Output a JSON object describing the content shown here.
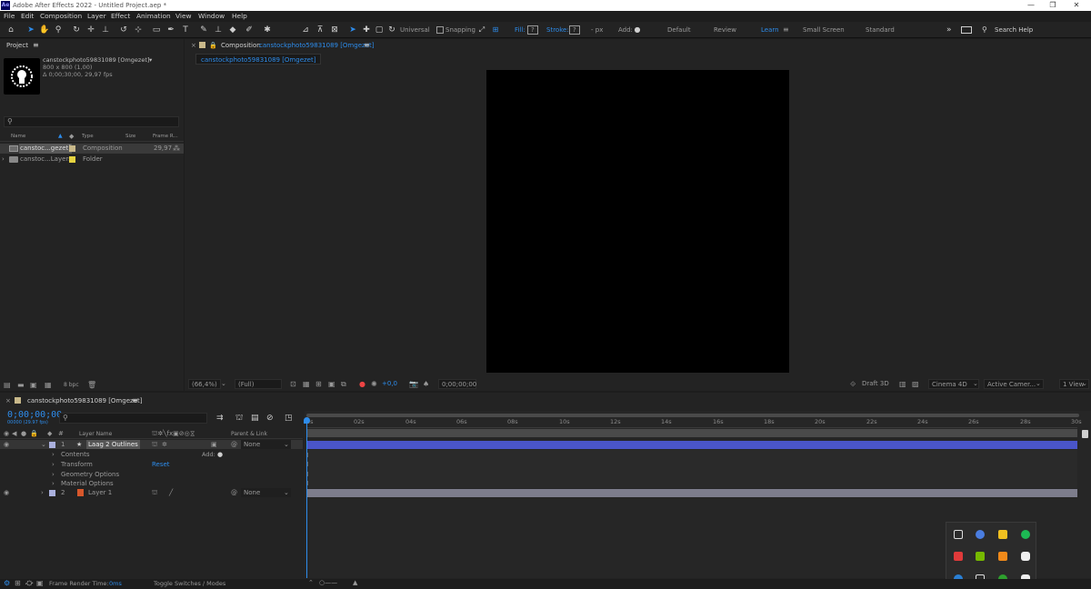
{
  "window": {
    "app_logo": "Ae",
    "title": "Adobe After Effects 2022 - Untitled Project.aep *",
    "minimize": "—",
    "maximize": "❐",
    "close": "✕"
  },
  "menu": [
    "File",
    "Edit",
    "Composition",
    "Layer",
    "Effect",
    "Animation",
    "View",
    "Window",
    "Help"
  ],
  "toolbar": {
    "universal_label": "Universal",
    "snapping_label": "Snapping",
    "fill_label": "Fill:",
    "fill_value": "?",
    "stroke_label": "Stroke:",
    "stroke_value": "?",
    "stroke_unit": "- px",
    "add_label": "Add:",
    "workspaces": [
      "Default",
      "Review",
      "Learn",
      "Small Screen",
      "Standard"
    ],
    "active_workspace": "Learn",
    "overflow": "»",
    "search_placeholder": "Search Help"
  },
  "project": {
    "panel_title": "Project",
    "menu_icon": "≡",
    "selected_name": "canstockphoto59831089 [Omgezet]",
    "selected_dims": "800 x 800 (1,00)",
    "selected_duration": "Δ 0;00;30;00, 29,97 fps",
    "columns": {
      "name": "Name",
      "type": "Type",
      "size": "Size",
      "frame_rate": "Frame R..."
    },
    "items": [
      {
        "name": "canstoc...gezet]",
        "type": "Composition",
        "color": "#c8b88a",
        "frame_rate": "29,97"
      },
      {
        "name": "canstoc...Layers",
        "type": "Folder",
        "color": "#e6d340",
        "frame_rate": ""
      }
    ],
    "bpc": "8 bpc"
  },
  "comp": {
    "panel_title": "Composition",
    "comp_name": "canstockphoto59831089 [Omgezet]",
    "tab_label": "canstockphoto59831089 [Omgezet]",
    "zoom": "(66,4%)",
    "resolution": "(Full)",
    "exposure": "+0,0",
    "timecode": "0;00;00;00",
    "draft3d": "Draft 3D",
    "renderer": "Cinema 4D",
    "camera": "Active Camer...",
    "views": "1 View"
  },
  "timeline": {
    "tab_label": "canstockphoto59831089 [Omgezet]",
    "timecode": "0;00;00;00",
    "frame_info": "00000 (29.97 fps)",
    "columns": {
      "layer_name": "Layer Name",
      "parent": "Parent & Link"
    },
    "ruler": [
      "0s",
      "02s",
      "04s",
      "06s",
      "08s",
      "10s",
      "12s",
      "14s",
      "16s",
      "18s",
      "20s",
      "22s",
      "24s",
      "26s",
      "28s",
      "30s"
    ],
    "layers": [
      {
        "num": "1",
        "name": "Laag 2 Outlines",
        "parent": "None",
        "color": "#aab0dd"
      },
      {
        "num": "2",
        "name": "Layer 1",
        "parent": "None",
        "color": "#aab0dd"
      }
    ],
    "sub_props": [
      "Contents",
      "Transform",
      "Geometry Options",
      "Material Options"
    ],
    "add_label": "Add:",
    "reset_label": "Reset"
  },
  "status": {
    "frame_render_label": "Frame Render Time:",
    "frame_render_value": "0ms",
    "toggle_label": "Toggle Switches / Modes"
  },
  "colors": {
    "accent": "#2d8ceb",
    "layer_bar_1": "#4a55c8",
    "layer_bar_2": "#7d7d8c"
  }
}
